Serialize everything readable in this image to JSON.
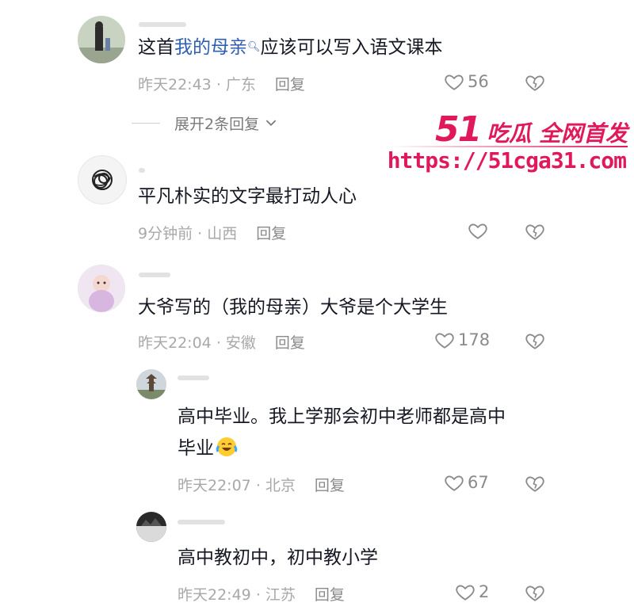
{
  "comments": [
    {
      "text_before": "这首",
      "keyword": "我的母亲",
      "text_after": "应该可以写入语文课本",
      "time": "昨天22:43",
      "location": "广东",
      "reply_label": "回复",
      "likes": "56",
      "expand_label": "展开2条回复"
    },
    {
      "text": "平凡朴实的文字最打动人心",
      "time": "9分钟前",
      "location": "山西",
      "reply_label": "回复",
      "likes": ""
    },
    {
      "text": "大爷写的（我的母亲）大爷是个大学生",
      "time": "昨天22:04",
      "location": "安徽",
      "reply_label": "回复",
      "likes": "178"
    }
  ],
  "replies": [
    {
      "text_line1": "高中毕业。我上学那会初中老师都是高中",
      "text_line2": "毕业",
      "time": "昨天22:07",
      "location": "北京",
      "reply_label": "回复",
      "likes": "67"
    },
    {
      "text": "高中教初中，初中教小学",
      "time": "昨天22:49",
      "location": "江苏",
      "reply_label": "回复",
      "likes": "2"
    }
  ],
  "watermark": {
    "brand_num": "51",
    "brand_text": "吃瓜 全网首发",
    "url": "https://51cga31.com"
  },
  "meta_separator": "·",
  "colors": {
    "keyword": "#2f5fb3",
    "watermark": "#e0195a",
    "meta": "#a8a8a8"
  },
  "icons": [
    "heart-outline-icon",
    "dislike-heart-icon",
    "search-icon",
    "chevron-down-icon",
    "laughing-crying-emoji-icon"
  ]
}
